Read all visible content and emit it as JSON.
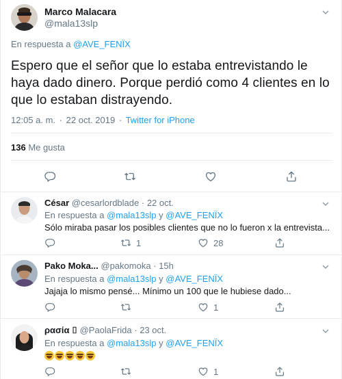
{
  "main_tweet": {
    "author_name": "Marco Malacara",
    "author_handle": "@mala13slp",
    "reply_prefix": "En respuesta a",
    "reply_to": "@AVE_FENÏX",
    "text": "Espero que el señor que lo estaba entrevistando le haya dado dinero. Porque perdió como 4 clientes en lo que lo estaban distrayendo.",
    "time": "12:05 a. m.",
    "date": "22 oct. 2019",
    "separator": "·",
    "source": "Twitter for iPhone",
    "likes_count": "136",
    "likes_label": "Me gusta"
  },
  "replies": [
    {
      "name": "César",
      "handle": "@cesarlordblade",
      "date": "· 22 oct.",
      "reply_prefix": "En respuesta a",
      "mention_1": "@mala13slp",
      "joiner": "y",
      "mention_2": "@AVE_FENÏX",
      "text": "Sólo miraba pasar los posibles clientes que no lo fueron x la entrevista...",
      "retweets": "1",
      "likes": "28"
    },
    {
      "name": "Pako Moka...",
      "handle": "@pakomoka",
      "date": "· 15h",
      "reply_prefix": "En respuesta a",
      "mention_1": "@mala13slp",
      "joiner": "y",
      "mention_2": "@AVE_FENÏX",
      "text": "Jajaja lo mismo pensé... Mínimo un 100 que le hubiese dado...",
      "retweets": "",
      "likes": "1"
    },
    {
      "name": "ρασία ⌷",
      "handle": "@PaolaFrida",
      "date": "· 23 oct.",
      "reply_prefix": "En respuesta a",
      "mention_1": "@mala13slp",
      "joiner": "y",
      "mention_2": "@AVE_FENÏX",
      "emoji_text": "🤣🤣🤣🤣🤣",
      "retweets": "",
      "likes": "1"
    }
  ],
  "icons": {
    "reply": "reply-icon",
    "retweet": "retweet-icon",
    "like": "heart-icon",
    "share": "share-icon",
    "more": "chevron-down-icon"
  },
  "colors": {
    "accent": "#1da1f2",
    "muted": "#657786",
    "text": "#14171a",
    "divider": "#e6ecf0"
  }
}
